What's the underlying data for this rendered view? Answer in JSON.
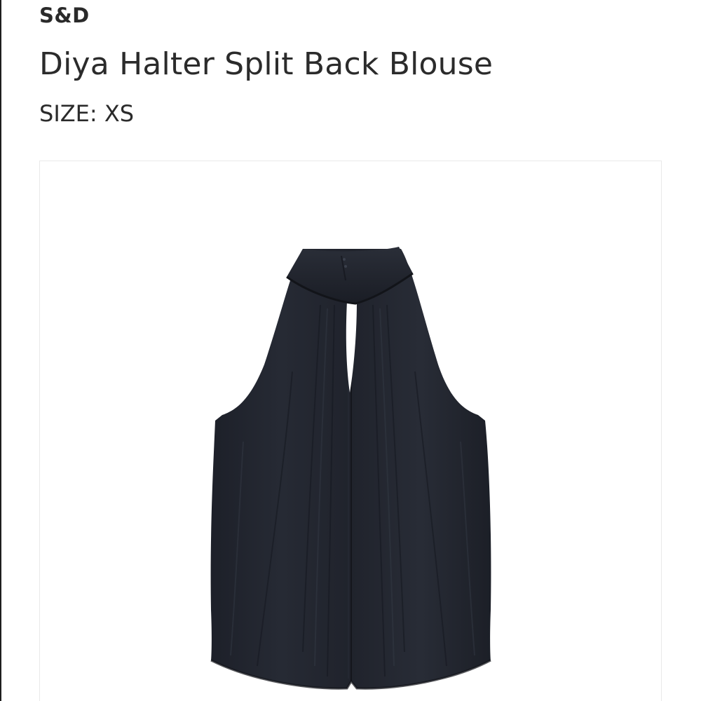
{
  "product": {
    "brand": "S&D",
    "name": "Diya Halter Split Back Blouse",
    "size_label": "SIZE:",
    "size_value": "XS"
  },
  "image": {
    "subject": "blouse-image",
    "garment_color": "#23262f"
  }
}
